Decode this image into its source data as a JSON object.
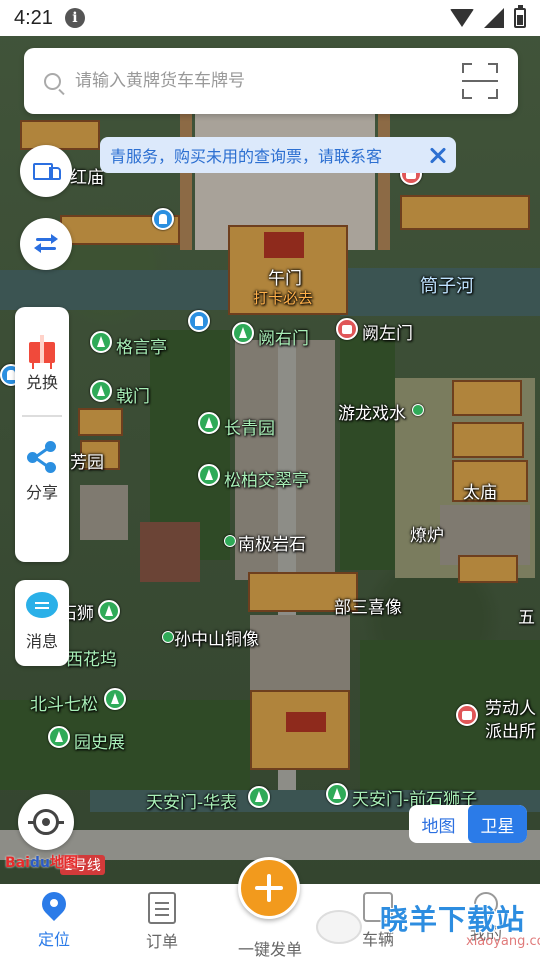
{
  "status_bar": {
    "time": "4:21"
  },
  "search": {
    "placeholder": "请输入黄牌货车车牌号"
  },
  "notice": {
    "text": "青服务，购买未用的查询票，请联系客"
  },
  "side_panel": {
    "exchange_label": "兑换",
    "share_label": "分享"
  },
  "messages": {
    "label": "消息"
  },
  "map_toggle": {
    "map_label": "地图",
    "satellite_label": "卫星",
    "active": "卫星"
  },
  "map": {
    "labels": {
      "wumen": "午门",
      "daka": "打卡必去",
      "tongzihe": "筒子河",
      "geyanting": "格言亭",
      "queyoumen": "阙右门",
      "quezuomen": "阙左门",
      "jimen": "戟门",
      "changqingyuan": "长青园",
      "youlongxishui": "游龙戏水",
      "fangyuan": "芳园",
      "songbai": "松柏交翠亭",
      "taimiao": "太庙",
      "liaolu": "燎炉",
      "nanjiyanshi": "南极岩石",
      "bushanxixiang": "部三喜像",
      "sunzhongshan": "孙中山铜像",
      "beidouqisong": "北斗七松",
      "yuanshizhan": "园史展",
      "laodongren": "劳动人",
      "paichusuo": "派出所",
      "tiananmen_huabiao": "天安门-华表",
      "tiananmen_shishizi": "天安门-前石狮子",
      "hongmiao": "红庙",
      "wu": "五",
      "line1": "1号线",
      "huashan": "西花坞",
      "shishi": "石狮"
    }
  },
  "logo": {
    "text": "Bai",
    "paw": "du",
    "suffix": "地图"
  },
  "bottom_nav": {
    "items": [
      {
        "label": "定位"
      },
      {
        "label": "订单"
      },
      {
        "label": "一键发单"
      },
      {
        "label": "车辆"
      },
      {
        "label": "我的"
      }
    ]
  },
  "watermark": {
    "text": "晓羊下载站",
    "sub": "xiaoyang.com"
  }
}
